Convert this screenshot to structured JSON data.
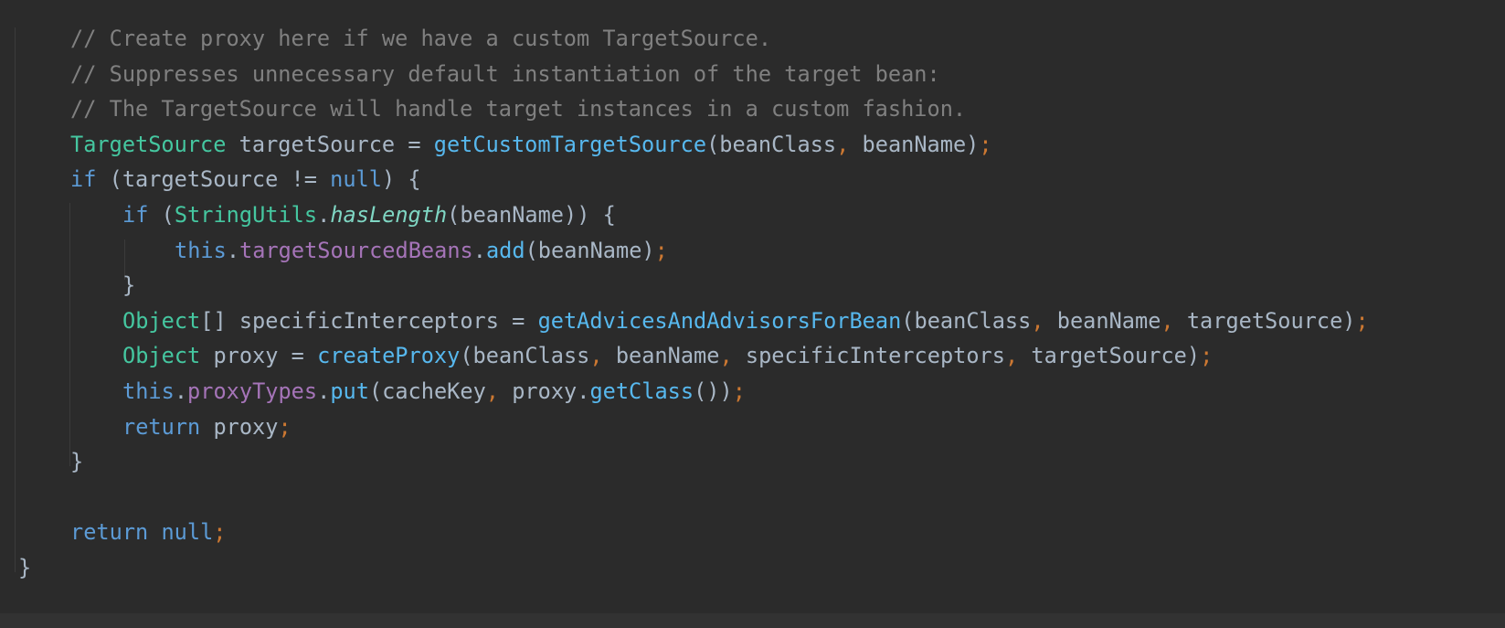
{
  "editor": {
    "language": "java",
    "colors": {
      "background": "#2b2b2b",
      "comment": "#808080",
      "keyword": "#5c9bd6",
      "type": "#45c7a0",
      "method": "#57b8ee",
      "field": "#a574b8",
      "punctuation": "#cc7832",
      "plain": "#a9b7c6"
    },
    "lines": [
      {
        "indent": 1,
        "tokens": [
          {
            "t": "// Create proxy here if we have a custom TargetSource.",
            "k": "comment"
          }
        ]
      },
      {
        "indent": 1,
        "tokens": [
          {
            "t": "// Suppresses unnecessary default instantiation of the target bean:",
            "k": "comment"
          }
        ]
      },
      {
        "indent": 1,
        "tokens": [
          {
            "t": "// The TargetSource will handle target instances in a custom fashion.",
            "k": "comment"
          }
        ]
      },
      {
        "indent": 1,
        "tokens": [
          {
            "t": "TargetSource",
            "k": "type"
          },
          {
            "t": " targetSource = ",
            "k": "plain"
          },
          {
            "t": "getCustomTargetSource",
            "k": "method"
          },
          {
            "t": "(beanClass",
            "k": "plain"
          },
          {
            "t": ",",
            "k": "punct"
          },
          {
            "t": " beanName)",
            "k": "plain"
          },
          {
            "t": ";",
            "k": "punct"
          }
        ]
      },
      {
        "indent": 1,
        "tokens": [
          {
            "t": "if",
            "k": "keyword"
          },
          {
            "t": " (targetSource != ",
            "k": "plain"
          },
          {
            "t": "null",
            "k": "keyword"
          },
          {
            "t": ") {",
            "k": "plain"
          }
        ]
      },
      {
        "indent": 2,
        "tokens": [
          {
            "t": "if",
            "k": "keyword"
          },
          {
            "t": " (",
            "k": "plain"
          },
          {
            "t": "StringUtils",
            "k": "type"
          },
          {
            "t": ".",
            "k": "plain"
          },
          {
            "t": "hasLength",
            "k": "italic"
          },
          {
            "t": "(beanName)) {",
            "k": "plain"
          }
        ]
      },
      {
        "indent": 3,
        "tokens": [
          {
            "t": "this",
            "k": "keyword"
          },
          {
            "t": ".",
            "k": "plain"
          },
          {
            "t": "targetSourcedBeans",
            "k": "field"
          },
          {
            "t": ".",
            "k": "plain"
          },
          {
            "t": "add",
            "k": "method"
          },
          {
            "t": "(beanName)",
            "k": "plain"
          },
          {
            "t": ";",
            "k": "punct"
          }
        ]
      },
      {
        "indent": 2,
        "tokens": [
          {
            "t": "}",
            "k": "plain"
          }
        ]
      },
      {
        "indent": 2,
        "tokens": [
          {
            "t": "Object",
            "k": "type"
          },
          {
            "t": "[] specificInterceptors = ",
            "k": "plain"
          },
          {
            "t": "getAdvicesAndAdvisorsForBean",
            "k": "method"
          },
          {
            "t": "(beanClass",
            "k": "plain"
          },
          {
            "t": ",",
            "k": "punct"
          },
          {
            "t": " beanName",
            "k": "plain"
          },
          {
            "t": ",",
            "k": "punct"
          },
          {
            "t": " targetSource)",
            "k": "plain"
          },
          {
            "t": ";",
            "k": "punct"
          }
        ]
      },
      {
        "indent": 2,
        "tokens": [
          {
            "t": "Object",
            "k": "type"
          },
          {
            "t": " proxy = ",
            "k": "plain"
          },
          {
            "t": "createProxy",
            "k": "method"
          },
          {
            "t": "(beanClass",
            "k": "plain"
          },
          {
            "t": ",",
            "k": "punct"
          },
          {
            "t": " beanName",
            "k": "plain"
          },
          {
            "t": ",",
            "k": "punct"
          },
          {
            "t": " specificInterceptors",
            "k": "plain"
          },
          {
            "t": ",",
            "k": "punct"
          },
          {
            "t": " targetSource)",
            "k": "plain"
          },
          {
            "t": ";",
            "k": "punct"
          }
        ]
      },
      {
        "indent": 2,
        "tokens": [
          {
            "t": "this",
            "k": "keyword"
          },
          {
            "t": ".",
            "k": "plain"
          },
          {
            "t": "proxyTypes",
            "k": "field"
          },
          {
            "t": ".",
            "k": "plain"
          },
          {
            "t": "put",
            "k": "method"
          },
          {
            "t": "(cacheKey",
            "k": "plain"
          },
          {
            "t": ",",
            "k": "punct"
          },
          {
            "t": " proxy.",
            "k": "plain"
          },
          {
            "t": "getClass",
            "k": "method"
          },
          {
            "t": "())",
            "k": "plain"
          },
          {
            "t": ";",
            "k": "punct"
          }
        ]
      },
      {
        "indent": 2,
        "tokens": [
          {
            "t": "return",
            "k": "keyword"
          },
          {
            "t": " proxy",
            "k": "plain"
          },
          {
            "t": ";",
            "k": "punct"
          }
        ]
      },
      {
        "indent": 1,
        "tokens": [
          {
            "t": "}",
            "k": "plain"
          }
        ]
      },
      {
        "indent": 1,
        "tokens": []
      },
      {
        "indent": 1,
        "tokens": [
          {
            "t": "return",
            "k": "keyword"
          },
          {
            "t": " ",
            "k": "plain"
          },
          {
            "t": "null",
            "k": "keyword"
          },
          {
            "t": ";",
            "k": "punct"
          }
        ]
      },
      {
        "indent": 0,
        "tokens": [
          {
            "t": "}",
            "k": "plain"
          }
        ]
      }
    ]
  }
}
